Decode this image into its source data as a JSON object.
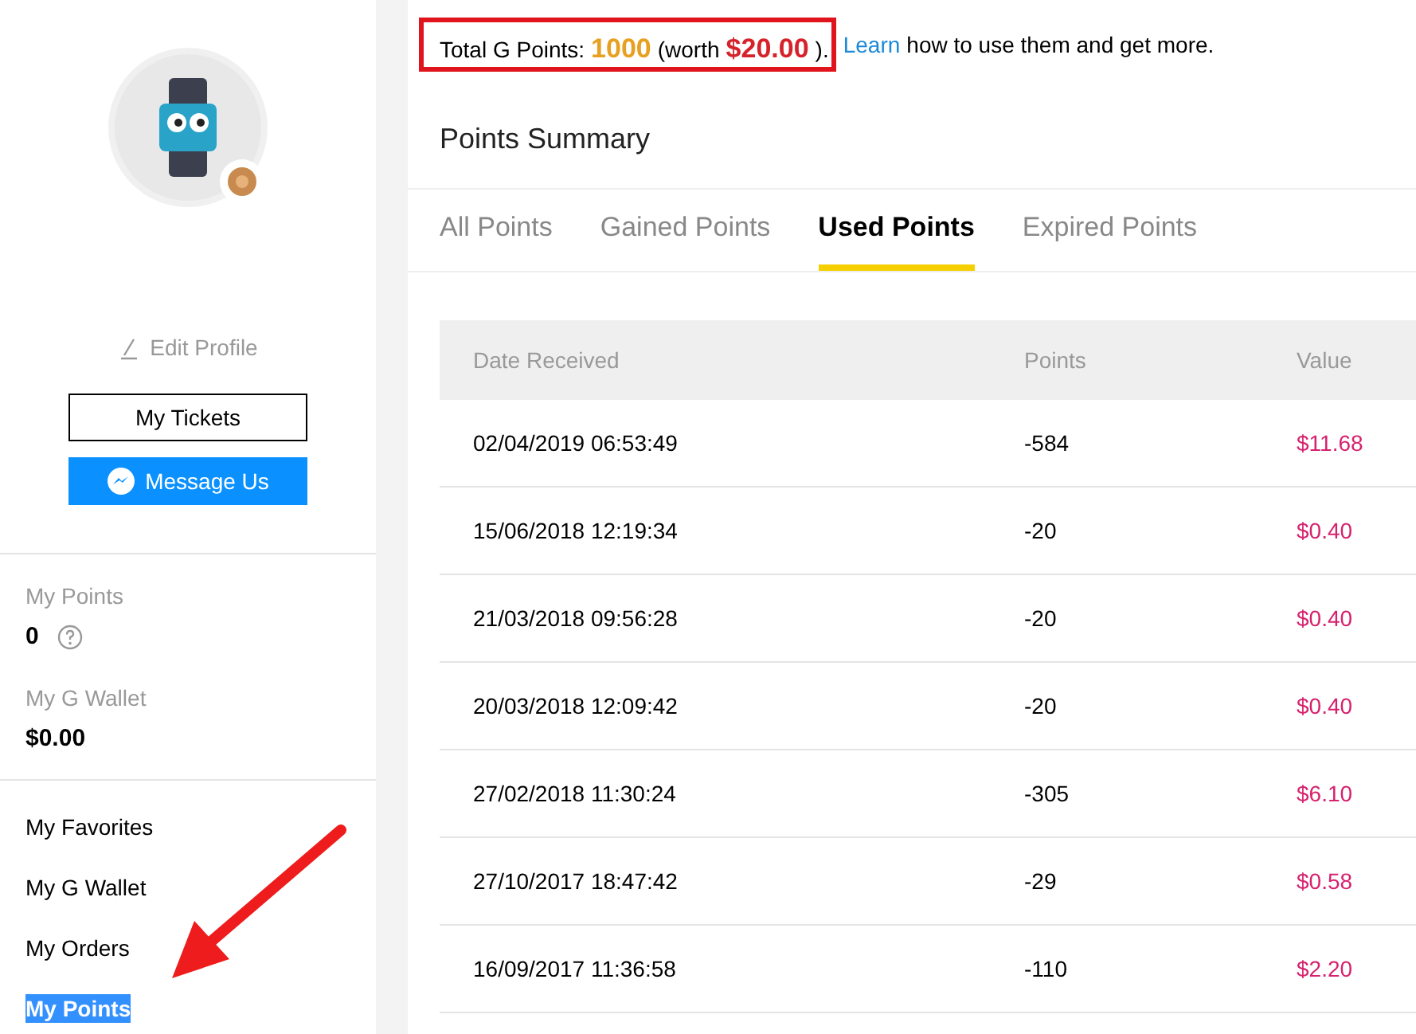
{
  "sidebar": {
    "edit_profile": "Edit Profile",
    "buttons": [
      {
        "label": "My Tickets",
        "kind": "outline"
      },
      {
        "label": "Message Us",
        "kind": "messenger"
      }
    ],
    "stats": [
      {
        "label": "My Points",
        "value": "0",
        "help": true
      },
      {
        "label": "My G Wallet",
        "value": "$0.00",
        "help": false
      }
    ],
    "menu": [
      {
        "label": "My Favorites",
        "selected": false
      },
      {
        "label": "My G Wallet",
        "selected": false
      },
      {
        "label": "My Orders",
        "selected": false
      },
      {
        "label": "My Points",
        "selected": true
      }
    ]
  },
  "summary": {
    "label": "Total G Points:",
    "points": "1000",
    "worth_prefix": "(worth",
    "worth_value": "$20.00",
    "worth_suffix": ").",
    "link": "Learn",
    "rest": "how to use them and get more."
  },
  "section_title": "Points Summary",
  "tabs": [
    {
      "label": "All Points",
      "selected": false
    },
    {
      "label": "Gained Points",
      "selected": false
    },
    {
      "label": "Used Points",
      "selected": true
    },
    {
      "label": "Expired Points",
      "selected": false
    }
  ],
  "table": {
    "columns": [
      "Date Received",
      "Points",
      "Value"
    ],
    "rows": [
      [
        "02/04/2019 06:53:49",
        "-584",
        "$11.68"
      ],
      [
        "15/06/2018 12:19:34",
        "-20",
        "$0.40"
      ],
      [
        "21/03/2018 09:56:28",
        "-20",
        "$0.40"
      ],
      [
        "20/03/2018 12:09:42",
        "-20",
        "$0.40"
      ],
      [
        "27/02/2018 11:30:24",
        "-305",
        "$6.10"
      ],
      [
        "27/10/2017 18:47:42",
        "-29",
        "$0.58"
      ],
      [
        "16/09/2017 11:36:58",
        "-110",
        "$2.20"
      ]
    ]
  }
}
